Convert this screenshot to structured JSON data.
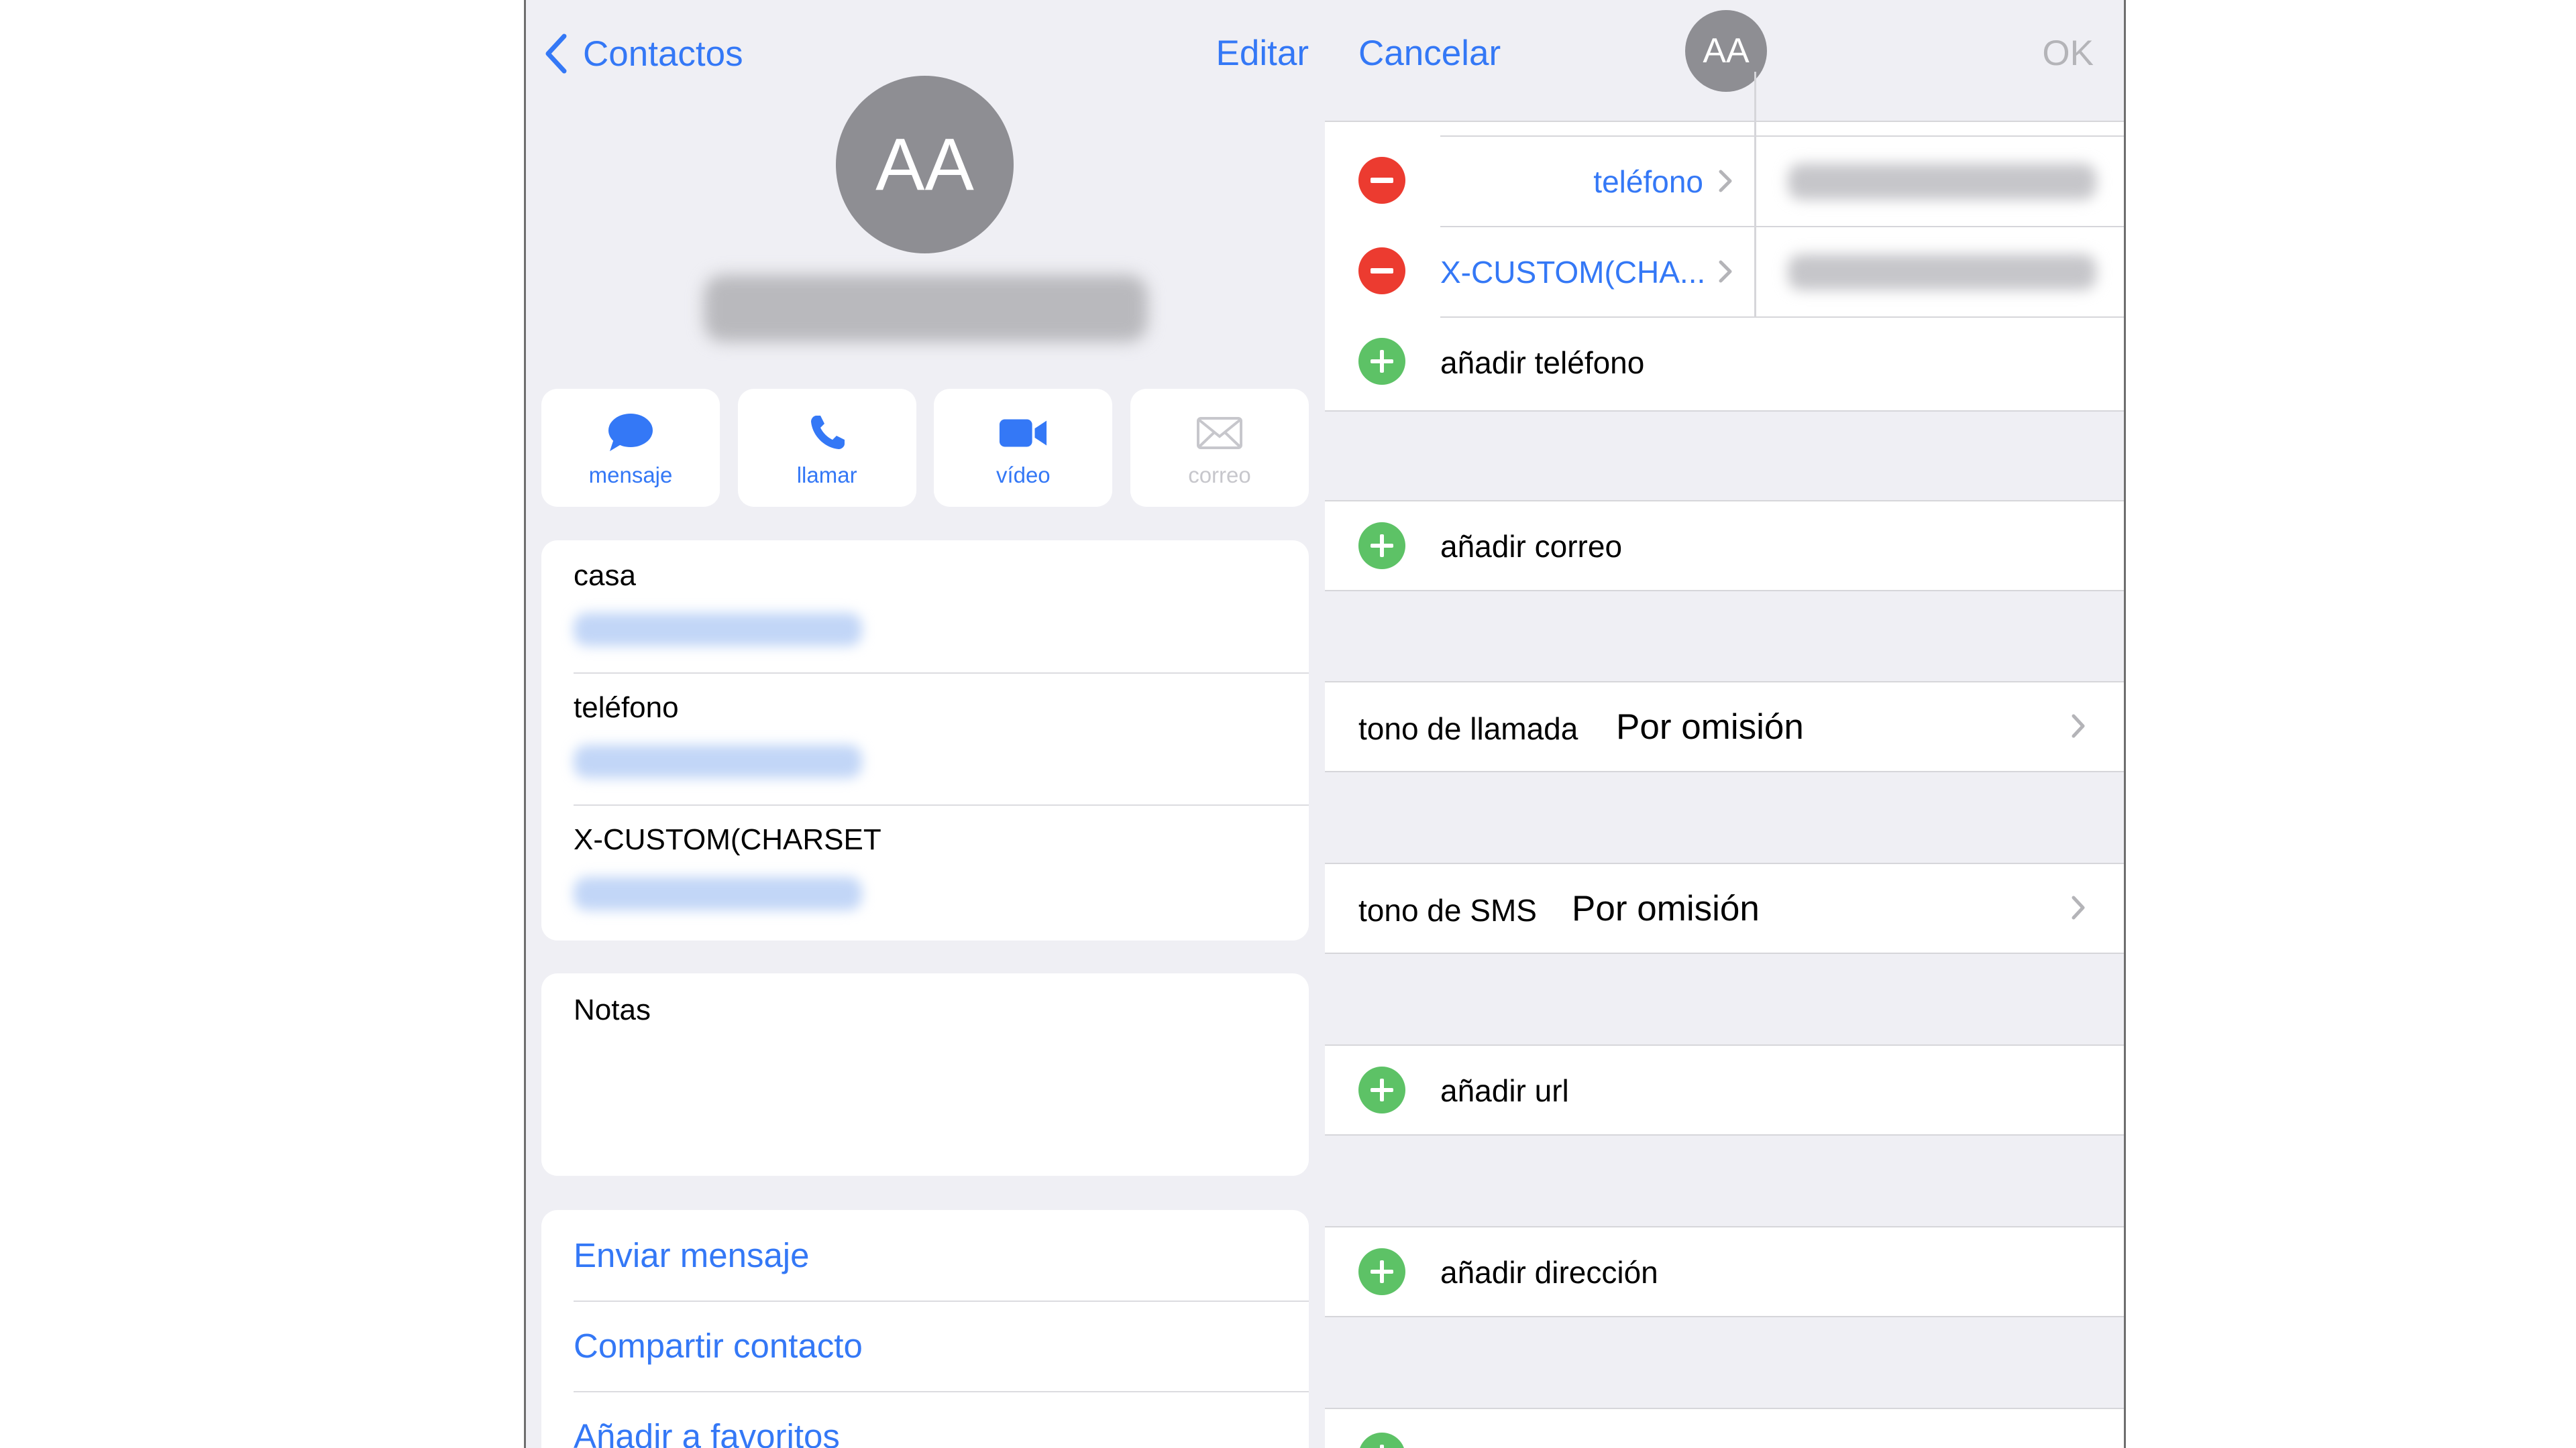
{
  "left": {
    "nav": {
      "back_label": "Contactos",
      "edit_label": "Editar"
    },
    "avatar_initials": "AA",
    "actions": [
      {
        "label": "mensaje",
        "icon": "message-icon"
      },
      {
        "label": "llamar",
        "icon": "phone-icon"
      },
      {
        "label": "vídeo",
        "icon": "video-icon"
      },
      {
        "label": "correo",
        "icon": "mail-icon"
      }
    ],
    "info": [
      {
        "label": "casa"
      },
      {
        "label": "teléfono"
      },
      {
        "label": "X-CUSTOM(CHARSET"
      }
    ],
    "notes_label": "Notas",
    "links": [
      "Enviar mensaje",
      "Compartir contacto",
      "Añadir a favoritos"
    ]
  },
  "right": {
    "cancel_label": "Cancelar",
    "avatar_initials": "AA",
    "ok_label": "OK",
    "phones": [
      {
        "type": "teléfono"
      },
      {
        "type": "X-CUSTOM(CHA..."
      }
    ],
    "add_phone": "añadir teléfono",
    "add_email": "añadir correo",
    "ringtone": {
      "label": "tono de llamada",
      "value": "Por omisión"
    },
    "texttone": {
      "label": "tono de SMS",
      "value": "Por omisión"
    },
    "add_url": "añadir url",
    "add_address": "añadir dirección"
  },
  "colors": {
    "accent": "#3478f6",
    "remove": "#ec3b30",
    "add": "#5dc266",
    "avatar": "#8e8e93",
    "background": "#efeff4"
  }
}
